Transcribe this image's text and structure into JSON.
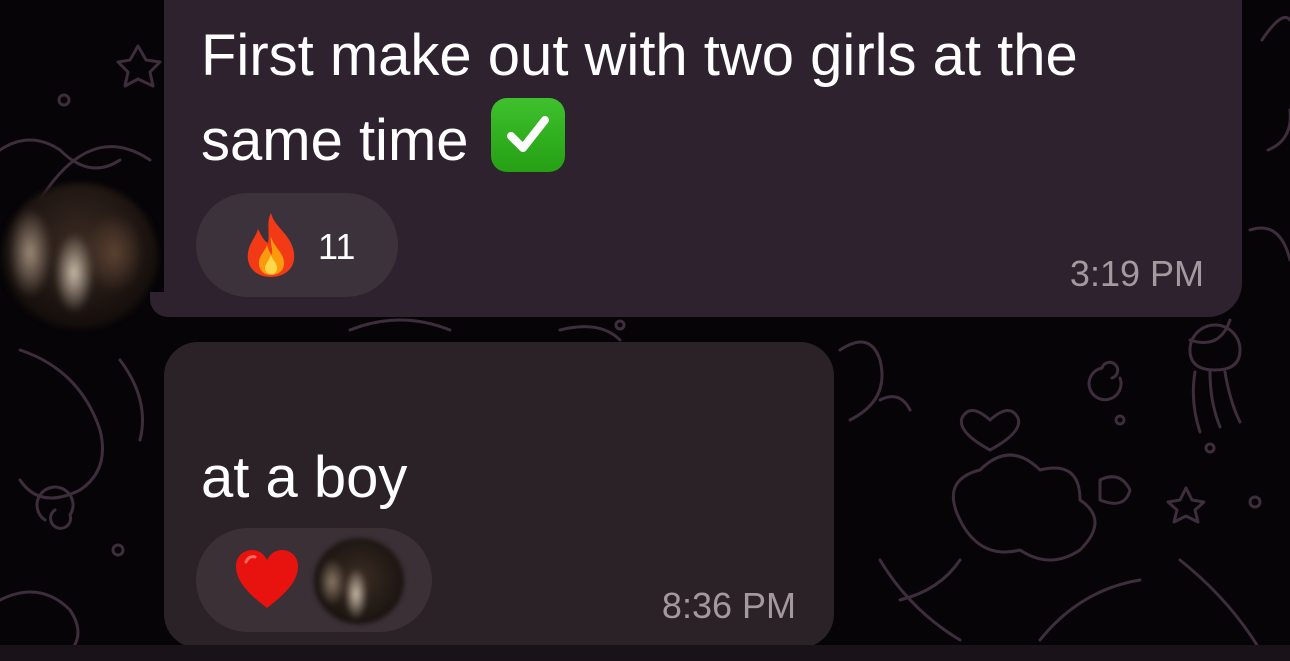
{
  "messages": [
    {
      "text": "First make out with two girls at the\nsame time",
      "emoji": "check-mark-button",
      "reactions": [
        {
          "emoji": "fire",
          "count": "11"
        }
      ],
      "time": "3:19 PM"
    },
    {
      "text": "at a boy",
      "reactions": [
        {
          "emoji": "red-heart",
          "reactor": "user-avatar"
        }
      ],
      "time": "8:36 PM"
    }
  ],
  "colors": {
    "background": "#060407",
    "bubble": "#2d222e",
    "reaction_pill": "#3b323c",
    "timestamp": "#a3999f",
    "pattern": "#3e2d3c"
  }
}
